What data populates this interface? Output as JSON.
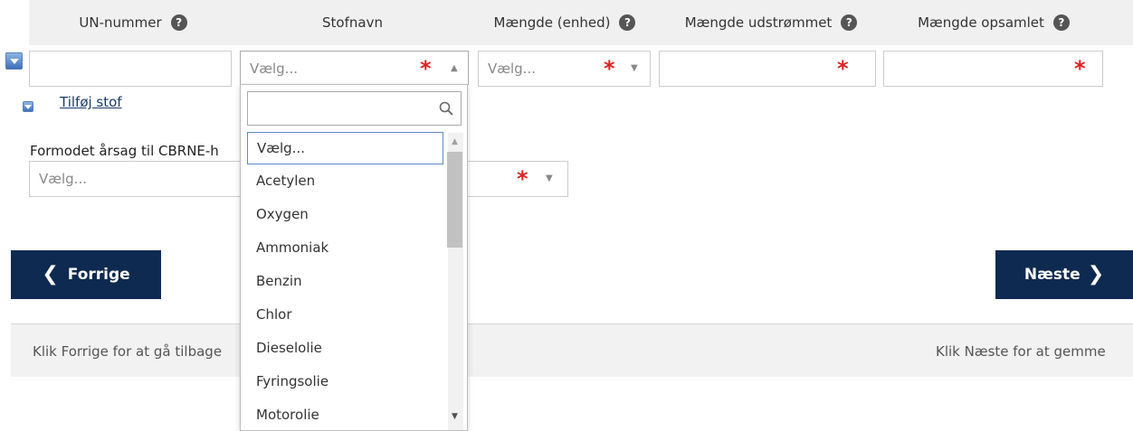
{
  "table": {
    "headers": [
      {
        "label": "UN-nummer",
        "help": true
      },
      {
        "label": "Stofnavn",
        "help": false
      },
      {
        "label": "Mængde (enhed)",
        "help": true
      },
      {
        "label": "Mængde udstrømmet",
        "help": true
      },
      {
        "label": "Mængde opsamlet",
        "help": true
      }
    ],
    "row": {
      "un_value": "",
      "stofnavn_placeholder": "Vælg...",
      "enhed_placeholder": "Vælg...",
      "udstroemmet_value": "",
      "opsamlet_value": ""
    },
    "add_link": "Tilføj stof"
  },
  "cause": {
    "label": "Formodet årsag til CBRNE-h",
    "placeholder": "Vælg..."
  },
  "required_mark": "*",
  "nav": {
    "prev_label": "Forrige",
    "next_label": "Næste",
    "prev_hint": "Klik Forrige for at gå tilbage",
    "next_hint": "Klik Næste for at gemme"
  },
  "dropdown": {
    "search_value": "",
    "options": [
      "Vælg...",
      "Acetylen",
      "Oxygen",
      "Ammoniak",
      "Benzin",
      "Chlor",
      "Dieselolie",
      "Fyringsolie",
      "Motorolie"
    ],
    "selected_index": 0
  },
  "icons": {
    "help": "question-circle-icon",
    "search": "search-icon",
    "toggle": "expand-toggle-icon",
    "prev": "chevron-left-icon",
    "next": "chevron-right-icon"
  },
  "colors": {
    "nav_button": "#0f2a50",
    "required": "#e02020",
    "header_bg": "#f0f0f0",
    "selected_border": "#5b8ac8"
  }
}
